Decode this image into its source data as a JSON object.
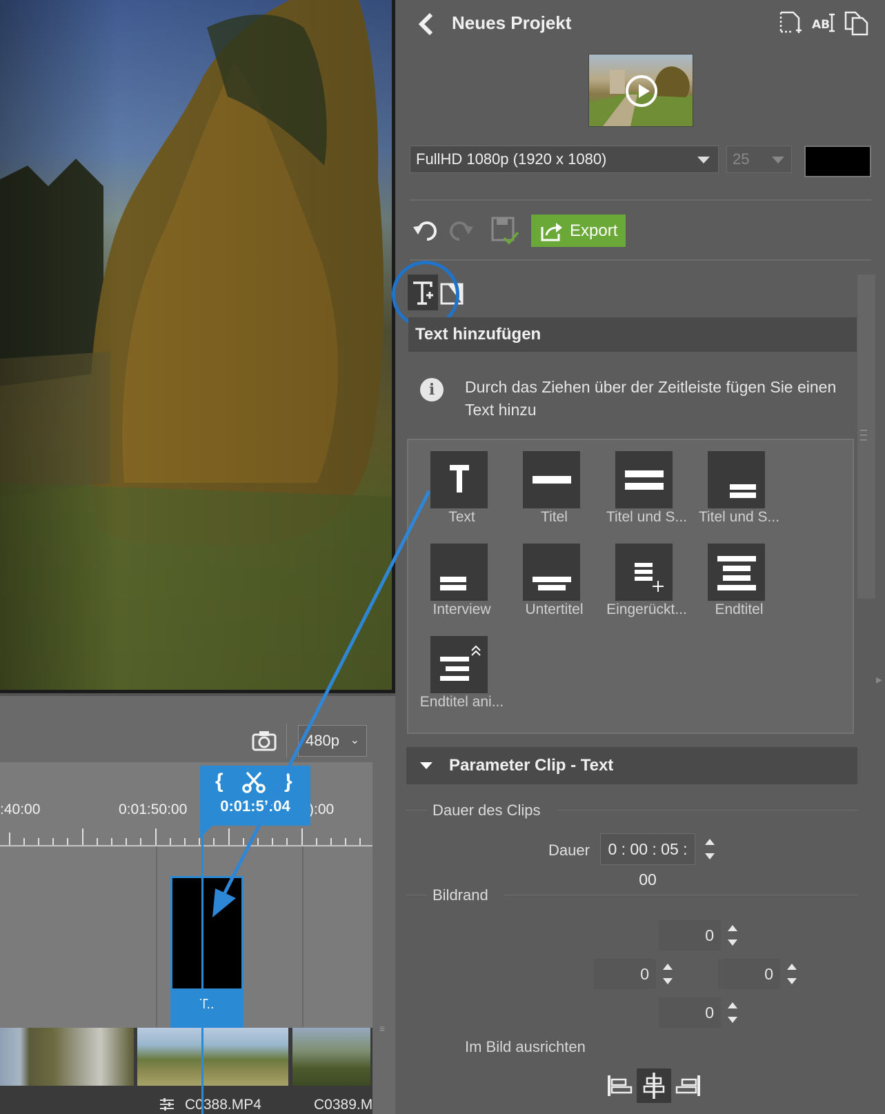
{
  "header": {
    "title": "Neues Projekt",
    "icons": [
      "new-page-icon",
      "rename-icon",
      "copy-icon"
    ]
  },
  "project": {
    "resolution": "FullHD 1080p (1920 x 1080)",
    "fps": "25",
    "background_color": "#000000"
  },
  "toolbar": {
    "export_label": "Export"
  },
  "text_section": {
    "title": "Text hinzufügen",
    "info": "Durch das Ziehen über der Zeitleiste fügen Sie einen Text hinzu",
    "templates": [
      {
        "label": "Text"
      },
      {
        "label": "Titel"
      },
      {
        "label": "Titel und S..."
      },
      {
        "label": "Titel und S..."
      },
      {
        "label": "Interview"
      },
      {
        "label": "Untertitel"
      },
      {
        "label": "Eingerückt..."
      },
      {
        "label": "Endtitel"
      },
      {
        "label": "Endtitel ani..."
      }
    ]
  },
  "params": {
    "title": "Parameter Clip - Text",
    "clip_duration_group": "Dauer des Clips",
    "duration_label": "Dauer",
    "duration_value": "0 : 00 : 05 : 00",
    "border_group": "Bildrand",
    "border_top": "0",
    "border_left": "0",
    "border_right": "0",
    "border_bottom": "0",
    "align_label": "Im Bild ausrichten"
  },
  "timeline": {
    "quality": "480p",
    "time_labels": [
      ":40:00",
      "0:01:50:00",
      "):00"
    ],
    "playhead_time": "0:01:5’:04",
    "text_clip_label": "T..",
    "clips": [
      "C0388.MP4",
      "C0389.M"
    ]
  },
  "colors": {
    "accent": "#2a8ad4",
    "export": "#6aa838",
    "ring": "#1f73c9"
  }
}
